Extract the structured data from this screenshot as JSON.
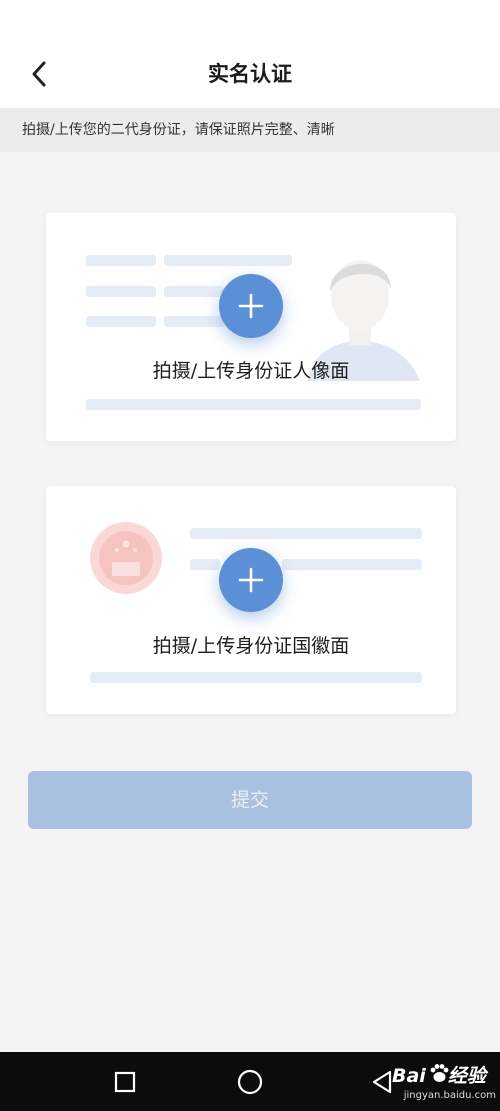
{
  "header": {
    "title": "实名认证",
    "back_icon": "chevron-left-icon"
  },
  "notice": {
    "text": "拍摄/上传您的二代身份证，请保证照片完整、清晰"
  },
  "cards": {
    "front": {
      "label": "拍摄/上传身份证人像面",
      "icon": "plus-icon"
    },
    "back": {
      "label": "拍摄/上传身份证国徽面",
      "icon": "plus-icon"
    }
  },
  "submit": {
    "label": "提交"
  },
  "navbar": {
    "icons": [
      "square-icon",
      "circle-icon",
      "triangle-back-icon"
    ]
  },
  "watermark": {
    "brand": "Bai",
    "brand_suffix": "经验",
    "site": "jingyan.baidu.com"
  },
  "colors": {
    "accent": "#5b8fd6",
    "submit_disabled": "#a9c1e1",
    "background": "#f4f4f4",
    "navbar": "#0c0c0c"
  }
}
